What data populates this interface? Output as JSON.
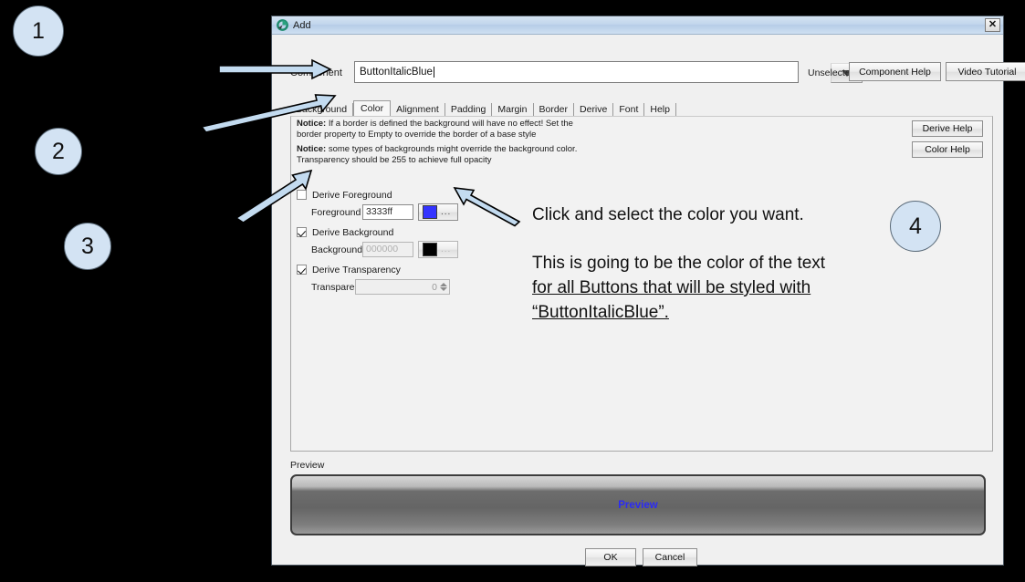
{
  "window": {
    "title": "Add",
    "icon": "app-icon",
    "close_label": "✕"
  },
  "component": {
    "label": "Component",
    "value": "ButtonItalicBlue",
    "placeholder": "",
    "dropdown_icon": "chevron-down-icon",
    "unselected_label": "Unselected",
    "component_help_label": "Component Help",
    "video_tutorial_label": "Video Tutorial"
  },
  "tabs": [
    {
      "label": "Background",
      "active": false
    },
    {
      "label": "Color",
      "active": true
    },
    {
      "label": "Alignment",
      "active": false
    },
    {
      "label": "Padding",
      "active": false
    },
    {
      "label": "Margin",
      "active": false
    },
    {
      "label": "Border",
      "active": false
    },
    {
      "label": "Derive",
      "active": false
    },
    {
      "label": "Font",
      "active": false
    },
    {
      "label": "Help",
      "active": false
    }
  ],
  "panel": {
    "notice1_bold": "Notice:",
    "notice1_text": " If a border is defined the background will have no effect! Set the border property to Empty to override the border of a base style",
    "notice2_bold": "Notice:",
    "notice2_text": " some types of backgrounds might override the background color. Transparency should be 255 to achieve full opacity",
    "derive_help_label": "Derive Help",
    "color_help_label": "Color Help"
  },
  "form": {
    "derive_foreground_label": "Derive Foreground",
    "derive_foreground_checked": false,
    "foreground_label": "Foreground",
    "foreground_value": "3333ff",
    "foreground_swatch": "#3333ff",
    "foreground_dots": "...",
    "derive_background_label": "Derive Background",
    "derive_background_checked": true,
    "background_label": "Background",
    "background_value": "000000",
    "background_swatch": "#000000",
    "background_dots": "...",
    "derive_transparency_label": "Derive Transparency",
    "derive_transparency_checked": true,
    "transparency_label": "Transparency",
    "transparency_value": "0"
  },
  "preview": {
    "label": "Preview",
    "button_text": "Preview",
    "button_text_color": "#2b2bf5"
  },
  "footer": {
    "ok_label": "OK",
    "cancel_label": "Cancel"
  },
  "callouts": [
    {
      "number": "1"
    },
    {
      "number": "2"
    },
    {
      "number": "3"
    },
    {
      "number": "4"
    }
  ],
  "annotations": {
    "line1": "Click and select the color you want.",
    "line2": "This is going to be the color of the text",
    "line3": "for all Buttons that will be styled with",
    "line4": "“ButtonItalicBlue”."
  },
  "colors": {
    "callout_fill": "#d3e3f3",
    "arrow_fill": "#c3dbf0",
    "arrow_stroke": "#000000",
    "backdrop": "#000000",
    "dialog_bg": "#f0f0f0"
  }
}
